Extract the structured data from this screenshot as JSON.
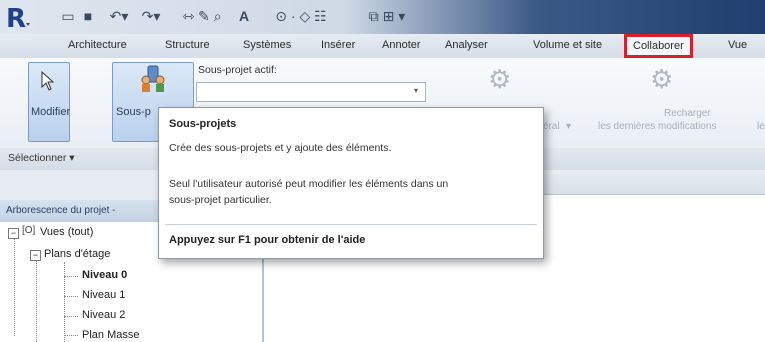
{
  "ribbon_tabs": [
    "Architecture",
    "Structure",
    "Systèmes",
    "Insérer",
    "Annoter",
    "Analyser",
    "Volume et site",
    "Collaborer",
    "Vue"
  ],
  "active_tab": "Collaborer",
  "highlight_color": "#d9202a",
  "ribbon": {
    "modify_label": "Modifier",
    "worksets_label": "Sous-p",
    "active_workset_label": "Sous-projet actif:",
    "select_label": "Sélectionner",
    "greyed_text_1": "éral",
    "reload_label_1": "Recharger",
    "reload_label_2": "les dernières modifications",
    "reload_label_tail": "le"
  },
  "browser": {
    "header": "Arborescence du projet -",
    "items": [
      "Vues (tout)",
      "Plans d'étage",
      "Niveau 0",
      "Niveau 1",
      "Niveau 2",
      "Plan Masse"
    ]
  },
  "tooltip": {
    "title": "Sous-projets",
    "line1": "Crée des sous-projets et y ajoute des éléments.",
    "line2": "Seul l'utilisateur autorisé peut modifier les éléments dans un",
    "line3": "sous-projet particulier.",
    "help": "Appuyez sur F1 pour obtenir de l'aide"
  },
  "icons": [
    "revit-logo-icon",
    "open-icon",
    "save-icon",
    "undo-icon",
    "redo-icon",
    "pointer-icon",
    "worksets-icon",
    "sync-icon",
    "reload-icon"
  ]
}
